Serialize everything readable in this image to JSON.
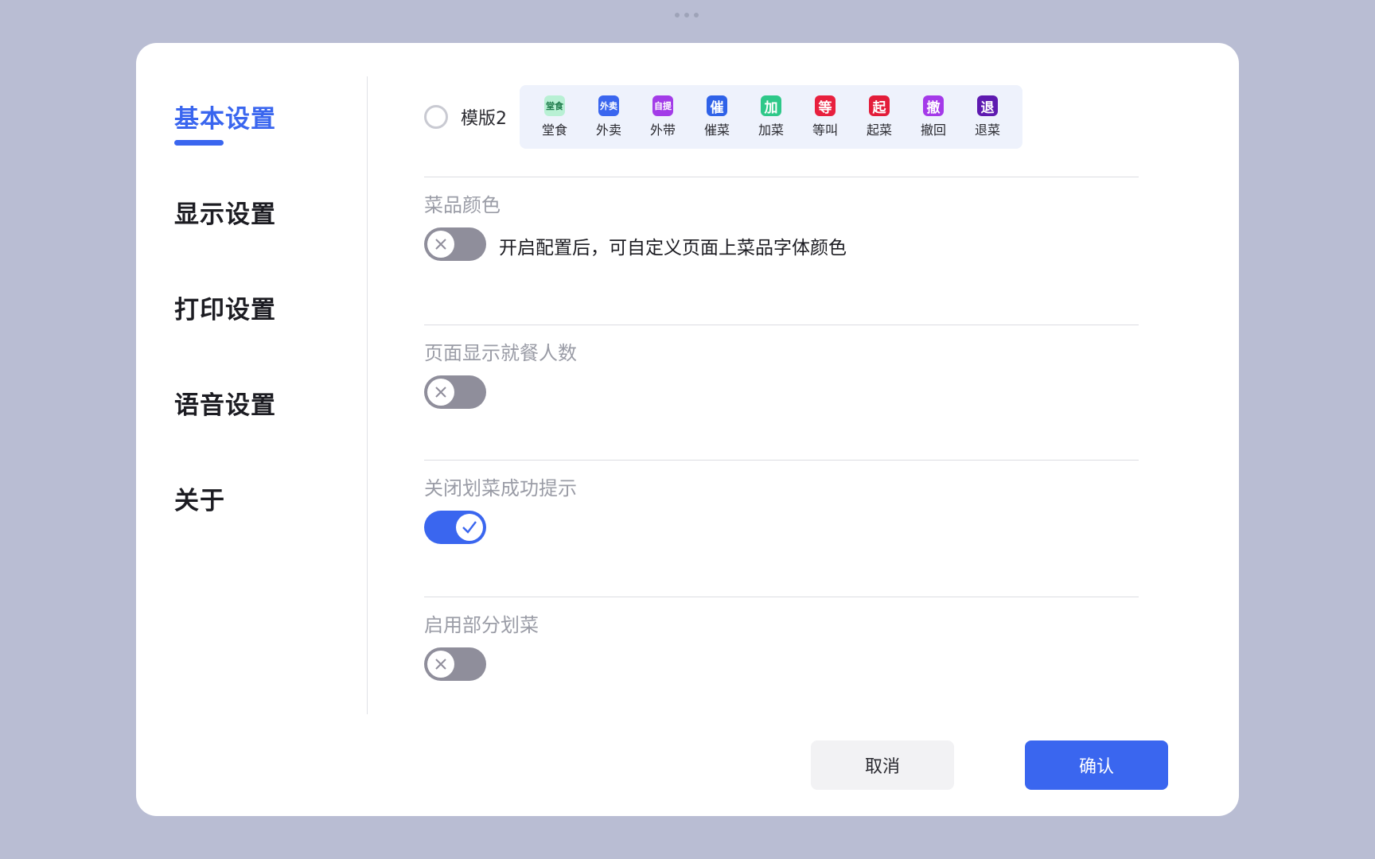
{
  "sidebar": {
    "items": [
      {
        "label": "基本设置"
      },
      {
        "label": "显示设置"
      },
      {
        "label": "打印设置"
      },
      {
        "label": "语音设置"
      },
      {
        "label": "关于"
      }
    ]
  },
  "template": {
    "label": "模版2",
    "tags": [
      {
        "badge": "堂食",
        "name": "堂食",
        "color": "#b8f0d4",
        "text_color": "#1d7a4a"
      },
      {
        "badge": "外卖",
        "name": "外卖",
        "color": "#3a66ef",
        "text_color": "#ffffff"
      },
      {
        "badge": "自提",
        "name": "外带",
        "color": "#a33ce8",
        "text_color": "#ffffff"
      },
      {
        "badge": "催",
        "name": "催菜",
        "color": "#2f62e8",
        "text_color": "#ffffff"
      },
      {
        "badge": "加",
        "name": "加菜",
        "color": "#2ec889",
        "text_color": "#ffffff"
      },
      {
        "badge": "等",
        "name": "等叫",
        "color": "#e8203e",
        "text_color": "#ffffff"
      },
      {
        "badge": "起",
        "name": "起菜",
        "color": "#e31d3a",
        "text_color": "#ffffff"
      },
      {
        "badge": "撤",
        "name": "撤回",
        "color": "#a43ae9",
        "text_color": "#ffffff"
      },
      {
        "badge": "退",
        "name": "退菜",
        "color": "#5e1ab0",
        "text_color": "#ffffff"
      }
    ]
  },
  "settings": {
    "dish_color": {
      "title": "菜品颜色",
      "desc": "开启配置后，可自定义页面上菜品字体颜色",
      "on": false
    },
    "guest_count": {
      "title": "页面显示就餐人数",
      "on": false
    },
    "close_tip": {
      "title": "关闭划菜成功提示",
      "on": true
    },
    "partial": {
      "title": "启用部分划菜",
      "on": false
    }
  },
  "buttons": {
    "cancel": "取消",
    "confirm": "确认"
  },
  "colors": {
    "accent": "#3a66ef",
    "toggle_off": "#8f8e9b"
  }
}
